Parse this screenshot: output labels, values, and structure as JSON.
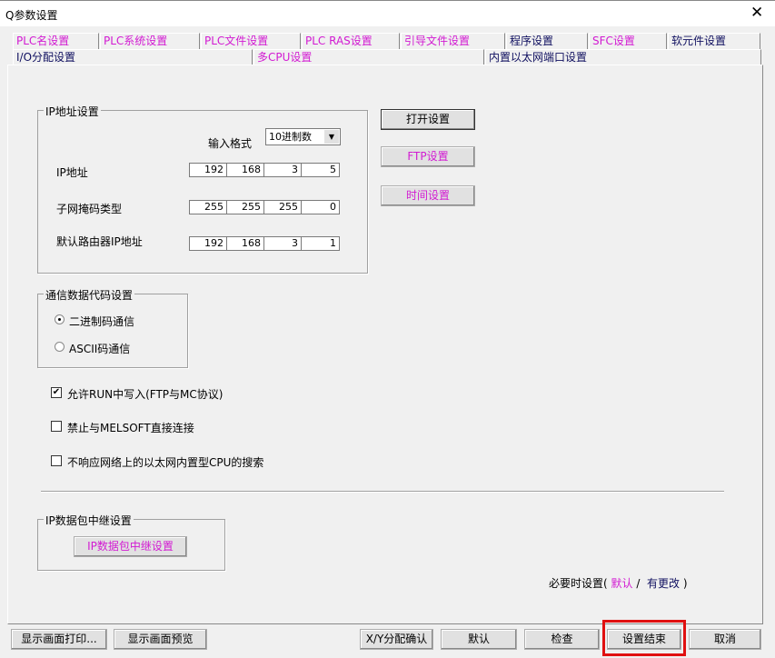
{
  "window": {
    "title": "Q参数设置",
    "close_icon": "close-icon"
  },
  "tabs_row1": [
    {
      "label": "PLC名设置",
      "color": "magenta"
    },
    {
      "label": "PLC系统设置",
      "color": "magenta"
    },
    {
      "label": "PLC文件设置",
      "color": "magenta"
    },
    {
      "label": "PLC RAS设置",
      "color": "magenta"
    },
    {
      "label": "引导文件设置",
      "color": "magenta"
    },
    {
      "label": "程序设置",
      "color": "blue"
    },
    {
      "label": "SFC设置",
      "color": "magenta"
    },
    {
      "label": "软元件设置",
      "color": "blue"
    }
  ],
  "tabs_row2": [
    {
      "label": "I/O分配设置"
    },
    {
      "label": "多CPU设置"
    },
    {
      "label": "内置以太网端口设置"
    }
  ],
  "ip_group": {
    "title": "IP地址设置",
    "input_format_label": "输入格式",
    "input_format_value": "10进制数",
    "ip_label": "IP地址",
    "ip": [
      "192",
      "168",
      "3",
      "5"
    ],
    "mask_label": "子网掩码类型",
    "mask": [
      "255",
      "255",
      "255",
      "0"
    ],
    "gateway_label": "默认路由器IP地址",
    "gateway": [
      "192",
      "168",
      "3",
      "1"
    ]
  },
  "side_buttons": {
    "open": "打开设置",
    "ftp": "FTP设置",
    "time": "时间设置"
  },
  "comm_group": {
    "title": "通信数据代码设置",
    "binary": "二进制码通信",
    "ascii": "ASCII码通信",
    "selected": "binary"
  },
  "checkboxes": [
    {
      "label": "允许RUN中写入(FTP与MC协议)",
      "checked": true
    },
    {
      "label": "禁止与MELSOFT直接连接",
      "checked": false
    },
    {
      "label": "不响应网络上的以太网内置型CPU的搜索",
      "checked": false
    }
  ],
  "relay_group": {
    "title": "IP数据包中继设置",
    "button": "IP数据包中继设置"
  },
  "legend_note": {
    "prefix": "必要时设置(",
    "default": "默认",
    "sep": "/",
    "changed": "有更改",
    "suffix": ")"
  },
  "bottom": {
    "print": "显示画面打印...",
    "preview": "显示画面预览",
    "xy": "X/Y分配确认",
    "default": "默认",
    "check": "检查",
    "end": "设置结束",
    "cancel": "取消"
  },
  "colors": {
    "magenta": "#d21ad2",
    "blue": "#101060",
    "highlight": "#e01010"
  }
}
